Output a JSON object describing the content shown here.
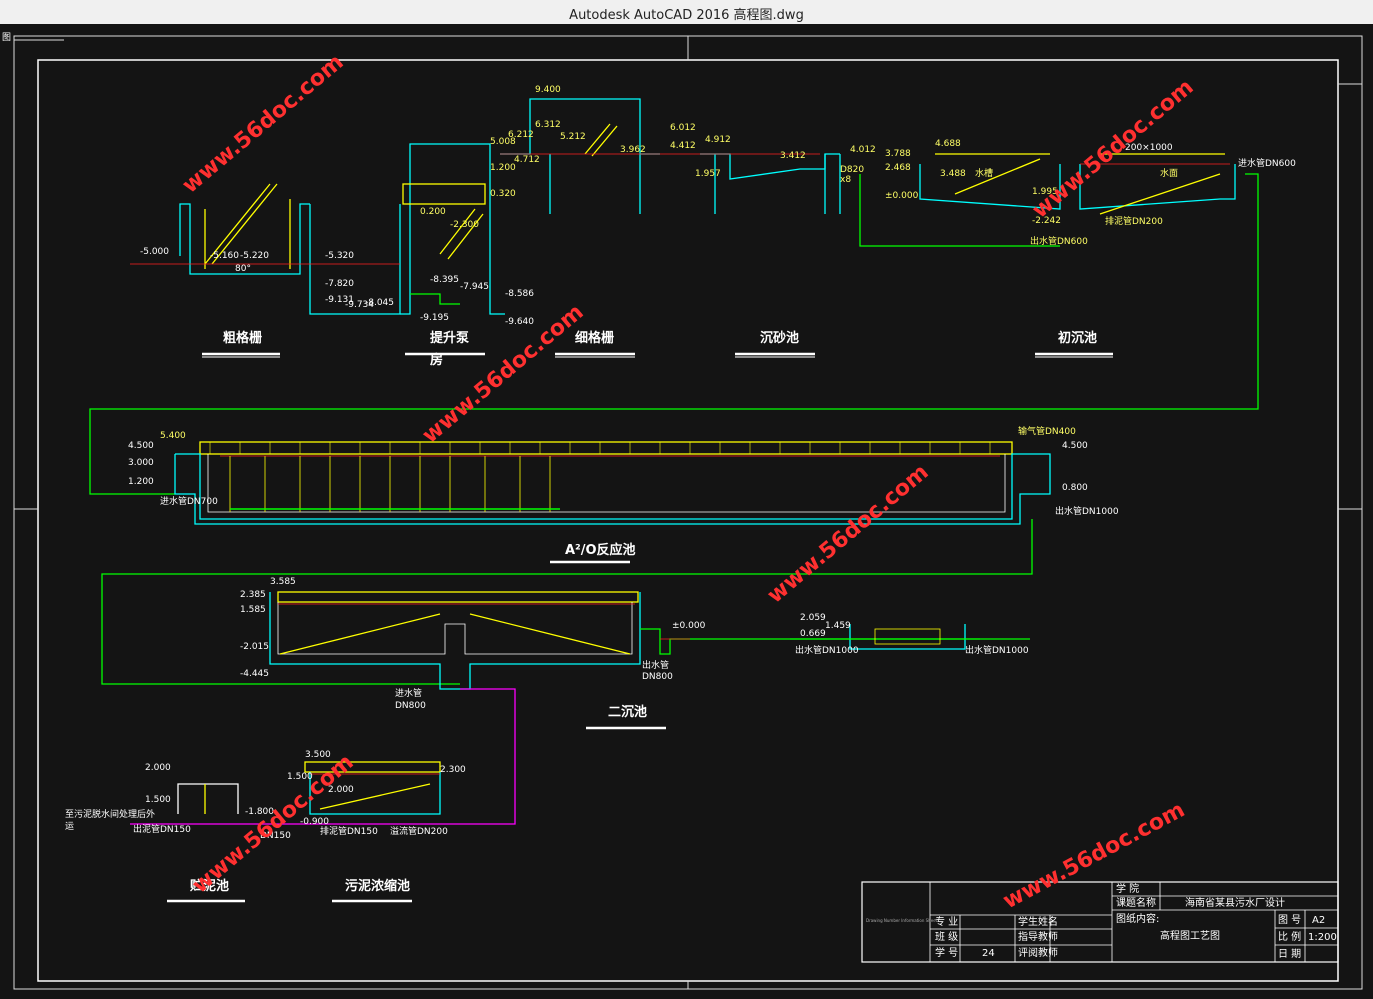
{
  "window": {
    "title": "Autodesk AutoCAD 2016     高程图.dwg",
    "icon_text": "图"
  },
  "watermark": "www.56doc.com",
  "stages": {
    "s1": "粗格栅",
    "s2": "提升泵",
    "s2b": "房",
    "s3": "细格栅",
    "s4": "沉砂池",
    "s5": "初沉池",
    "s6": "A²/O反应池",
    "s7": "二沉池",
    "s8": "贮泥池",
    "s9": "污泥浓缩池"
  },
  "elev_top": [
    "9.400",
    "6.312",
    "5.212",
    "6.012",
    "4.412",
    "4.912",
    "5.008",
    "6.212",
    "1.200",
    "4.712",
    "0.320",
    "3.962",
    "3.412",
    "4.012",
    "1.957",
    "D820",
    "x8",
    "3.788",
    "2.468",
    "±0.000",
    "4.688",
    "3.488",
    "1.995",
    "-2.242",
    "0.200",
    "-2.300",
    "-5.000",
    "-5.160",
    "-5.220",
    "80°",
    "-5.320",
    "-7.820",
    "-9.131",
    "-9.734",
    "-8.045",
    "-8.395",
    "-7.945",
    "-8.586",
    "-9.195",
    "-9.640"
  ],
  "labels_top": [
    "进水管DN600",
    "出水管DN600",
    "排泥管DN200",
    "水槽",
    "200×1000",
    "水面"
  ],
  "elev_mid": [
    "5.400",
    "4.500",
    "3.000",
    "1.200",
    "4.500",
    "0.800"
  ],
  "labels_mid": [
    "进水管DN700",
    "输气管DN400",
    "出水管DN1000"
  ],
  "elev_sec": [
    "3.585",
    "2.385",
    "1.585",
    "-2.015",
    "-4.445",
    "±0.000",
    "2.059",
    "1.459",
    "0.669"
  ],
  "labels_sec": [
    "出水管",
    "DN800",
    "出水管DN1000",
    "出水管DN1000",
    "进水管",
    "DN800"
  ],
  "elev_bot": [
    "2.000",
    "1.500",
    "-1.800",
    "3.500",
    "1.500",
    "2.300",
    "2.000",
    "-0.900"
  ],
  "labels_bot": [
    "至污泥脱水间处理后外",
    "运",
    "出泥管DN150",
    "排泥管DN150",
    "溢流管DN200",
    "DN150"
  ],
  "titleblock": {
    "school_label": "学 院",
    "project_label": "课题名称",
    "project_value": "海南省某县污水厂设计",
    "content_label": "图纸内容:",
    "content_value": "高程图工艺图",
    "major_label": "专 业",
    "class_label": "班 级",
    "id_label": "学 号",
    "id_value": "24",
    "student_label": "学生姓名",
    "advisor_label": "指导教师",
    "review_label": "评阅教师",
    "sheet_label": "图 号",
    "sheet_value": "A2",
    "scale_label": "比 例",
    "scale_value": "1:200",
    "date_label": "日 期",
    "small_note": "Drawing Number Information Sheet"
  },
  "colors": {
    "cyan": "#00ffff",
    "yellow": "#ffff00",
    "green": "#00ff00",
    "red": "#ff2020",
    "magenta": "#ff00ff",
    "white": "#ffffff"
  }
}
